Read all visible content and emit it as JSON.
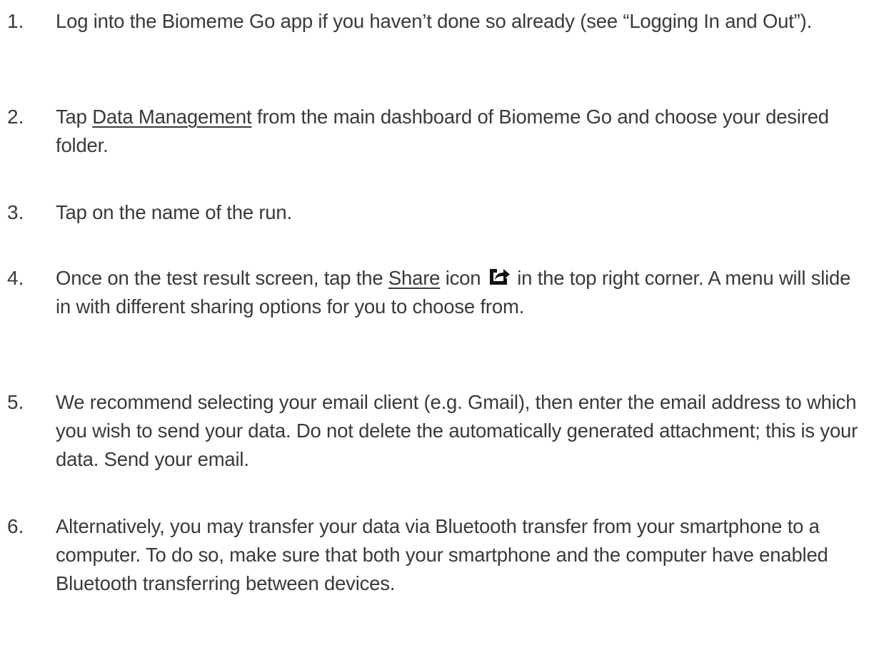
{
  "steps": [
    {
      "number": "1.",
      "text": "Log into the Biomeme Go app if you haven’t done so already (see “Logging In and Out”)."
    },
    {
      "number": "2.",
      "text_before": "Tap ",
      "link": "Data Management",
      "text_after": " from the main dashboard of Biomeme Go and choose your desired folder."
    },
    {
      "number": "3.",
      "text": "Tap on the name of the run."
    },
    {
      "number": "4.",
      "text_before": "Once on the test result screen, tap the ",
      "link": "Share",
      "text_middle": " icon ",
      "icon": "share-icon",
      "text_after": " in the top right corner. A menu will slide in with different sharing options for you to choose from."
    },
    {
      "number": "5.",
      "text": "We recommend selecting your email client (e.g. Gmail), then enter the email address to which you wish to send your data. Do not delete the automatically generated attachment; this is your data. Send your email."
    },
    {
      "number": "6.",
      "text": "Alternatively, you may transfer your data via Bluetooth transfer from your smartphone to a computer. To do so, make sure that both your smartphone and the computer have enabled Bluetooth transferring between devices."
    }
  ]
}
